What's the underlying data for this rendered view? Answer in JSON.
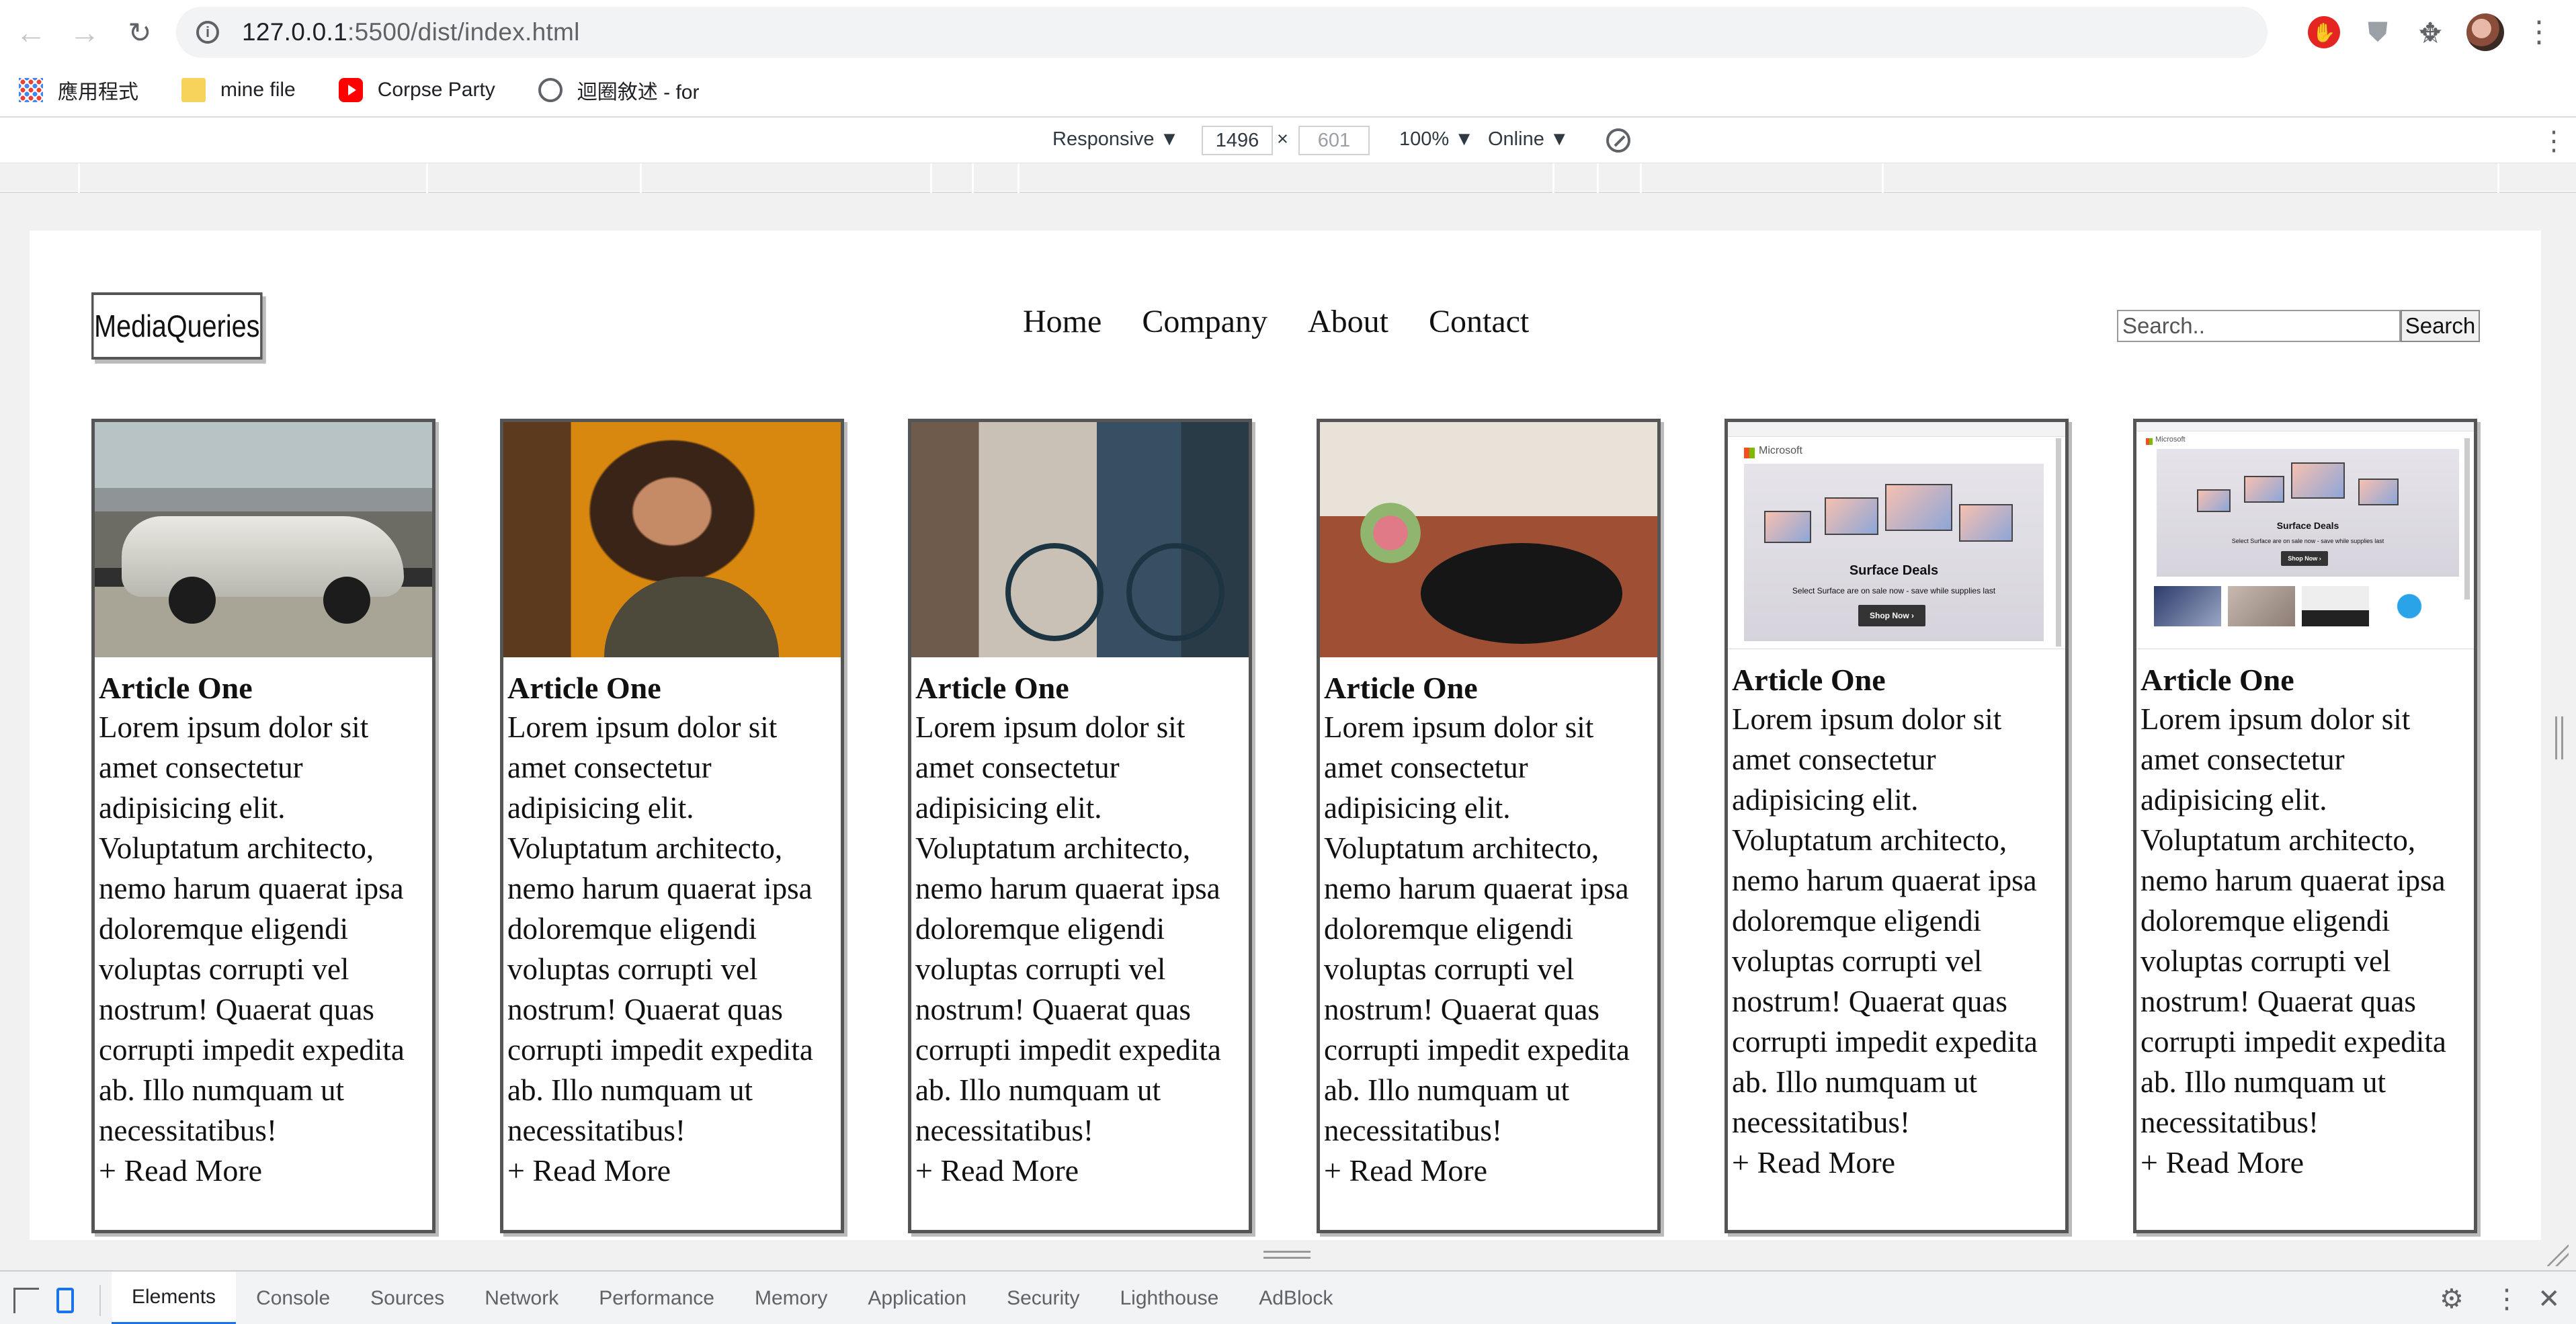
{
  "browser": {
    "url_host": "127.0.0.1",
    "url_path": ":5500/dist/index.html",
    "bookmarks": [
      {
        "label": "應用程式",
        "icon": "apps-icon"
      },
      {
        "label": "mine file",
        "icon": "folder-icon"
      },
      {
        "label": "Corpse Party",
        "icon": "youtube-icon"
      },
      {
        "label": "迴圈敘述 - for",
        "icon": "globe-icon"
      }
    ]
  },
  "device_toolbar": {
    "mode": "Responsive ▼",
    "width": "1496",
    "times": "×",
    "height": "601",
    "zoom": "100% ▼",
    "network": "Online ▼"
  },
  "page": {
    "logo": "MediaQueries",
    "nav": [
      "Home",
      "Company",
      "About",
      "Contact"
    ],
    "search_placeholder": "Search..",
    "search_button": "Search",
    "articles": [
      {
        "title": "Article One",
        "body": "Lorem ipsum dolor sit amet consectetur adipisicing elit. Voluptatum architecto, nemo harum quaerat ipsa doloremque eligendi voluptas corrupti vel nostrum! Quaerat quas corrupti impedit expedita ab. Illo numquam ut necessitatibus!",
        "more": "+ Read More",
        "image": "classic-car-photo"
      },
      {
        "title": "Article One",
        "body": "Lorem ipsum dolor sit amet consectetur adipisicing elit. Voluptatum architecto, nemo harum quaerat ipsa doloremque eligendi voluptas corrupti vel nostrum! Quaerat quas corrupti impedit expedita ab. Illo numquam ut necessitatibus!",
        "more": "+ Read More",
        "image": "woman-portrait-photo"
      },
      {
        "title": "Article One",
        "body": "Lorem ipsum dolor sit amet consectetur adipisicing elit. Voluptatum architecto, nemo harum quaerat ipsa doloremque eligendi voluptas corrupti vel nostrum! Quaerat quas corrupti impedit expedita ab. Illo numquam ut necessitatibus!",
        "more": "+ Read More",
        "image": "bicycle-photo"
      },
      {
        "title": "Article One",
        "body": "Lorem ipsum dolor sit amet consectetur adipisicing elit. Voluptatum architecto, nemo harum quaerat ipsa doloremque eligendi voluptas corrupti vel nostrum! Quaerat quas corrupti impedit expedita ab. Illo numquam ut necessitatibus!",
        "more": "+ Read More",
        "image": "record-player-photo"
      },
      {
        "title": "Article One",
        "body": "Lorem ipsum dolor sit amet consectetur adipisicing elit. Voluptatum architecto, nemo harum quaerat ipsa doloremque eligendi voluptas corrupti vel nostrum! Quaerat quas corrupti impedit expedita ab. Illo numquam ut necessitatibus!",
        "more": "+ Read More",
        "image": "microsoft-site-screenshot"
      },
      {
        "title": "Article One",
        "body": "Lorem ipsum dolor sit amet consectetur adipisicing elit. Voluptatum architecto, nemo harum quaerat ipsa doloremque eligendi voluptas corrupti vel nostrum! Quaerat quas corrupti impedit expedita ab. Illo numquam ut necessitatibus!",
        "more": "+ Read More",
        "image": "microsoft-site-screenshot"
      }
    ],
    "screenshot_texts": {
      "brand": "Microsoft",
      "deal": "Surface Deals",
      "deal_sub": "Select Surface are on sale now - save while supplies last",
      "shop": "Shop Now ›"
    }
  },
  "devtools": {
    "tabs": [
      "Elements",
      "Console",
      "Sources",
      "Network",
      "Performance",
      "Memory",
      "Application",
      "Security",
      "Lighthouse",
      "AdBlock"
    ],
    "active_tab": "Elements"
  },
  "colors": {
    "accent": "#1a73e8",
    "card_border": "#555555",
    "chrome_bg": "#f1f3f4"
  }
}
